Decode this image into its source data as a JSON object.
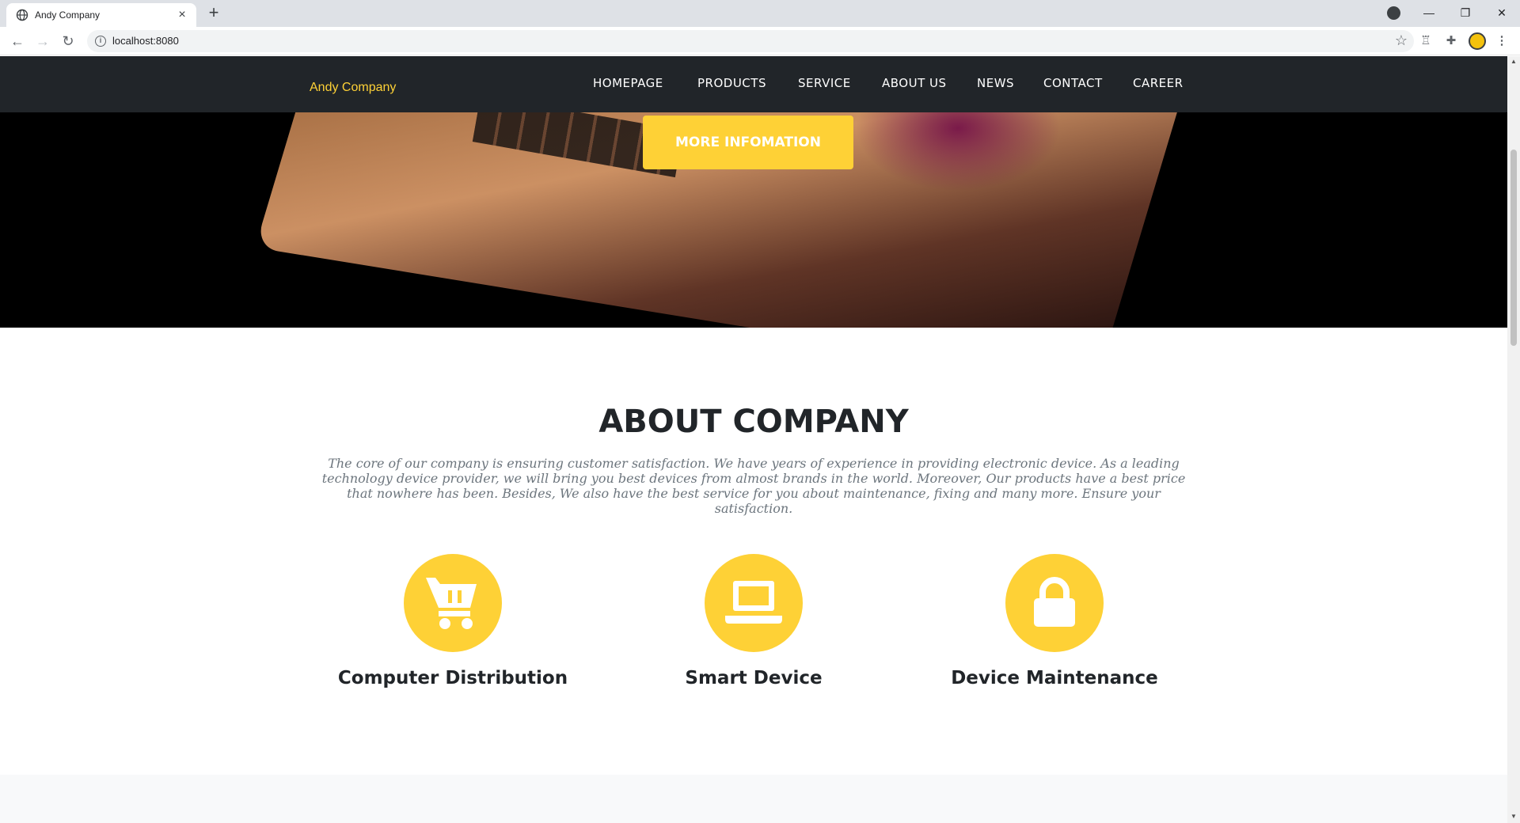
{
  "browser": {
    "tab_title": "Andy Company",
    "tab_close": "×",
    "new_tab": "+",
    "url": "localhost:8080",
    "window_controls": {
      "minimize": "—",
      "restore": "❐",
      "close": "✕"
    }
  },
  "site": {
    "brand": "Andy Company",
    "nav": [
      "HOMEPAGE",
      "PRODUCTS",
      "SERVICE",
      "ABOUT US",
      "NEWS",
      "CONTACT",
      "CAREER"
    ],
    "hero_button": "MORE INFOMATION"
  },
  "about": {
    "title": "ABOUT COMPANY",
    "text": "The core of our company is ensuring customer satisfaction. We have years of experience in providing electronic device. As a leading technology device provider, we will bring you best devices from almost brands in the world. Moreover, Our products have a best price that nowhere has been. Besides, We also have the best service for you about maintenance, fixing and many more. Ensure your satisfaction.",
    "features": [
      {
        "icon": "shopping-cart-icon",
        "title": "Computer Distribution"
      },
      {
        "icon": "laptop-icon",
        "title": "Smart Device"
      },
      {
        "icon": "lock-icon",
        "title": "Device Maintenance"
      }
    ]
  },
  "colors": {
    "accent": "#fed136",
    "nav_bg": "#212529",
    "text_dark": "#212529",
    "text_muted": "#6c757d"
  }
}
